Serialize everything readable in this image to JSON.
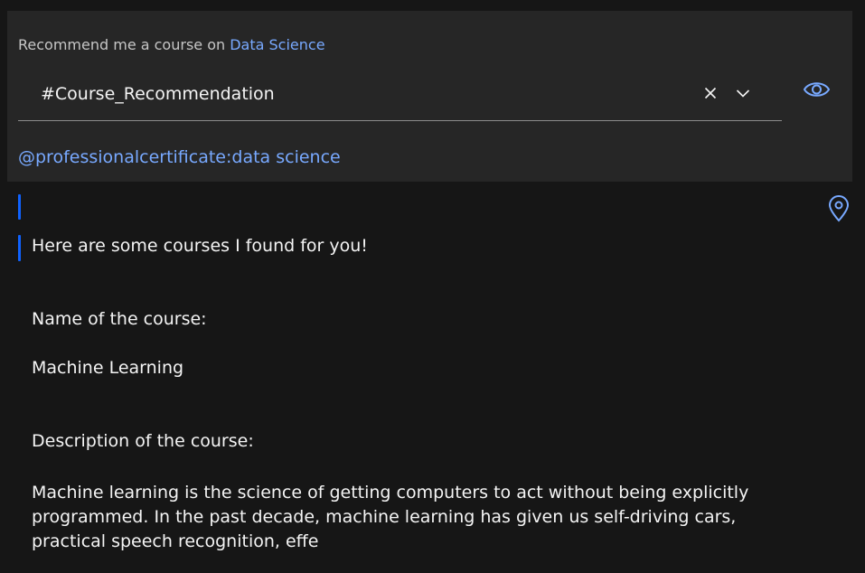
{
  "prompt": {
    "prefix": "Recommend me a course on ",
    "topic_link": "Data Science"
  },
  "dropdown": {
    "value": "#Course_Recommendation",
    "clear_icon": "close-icon",
    "expand_icon": "chevron-down-icon"
  },
  "mention": "@professionalcertificate:data science",
  "icons": {
    "eye": "eye-icon",
    "pin": "location-pin-icon"
  },
  "colors": {
    "background": "#161616",
    "panel": "#262626",
    "link": "#78a9ff",
    "accent": "#0f62fe",
    "text": "#f4f4f4"
  },
  "response": {
    "intro": "Here are some courses I found for you!",
    "name_label": "Name of the course:",
    "name_value": "Machine Learning",
    "description_label": "Description of the course:",
    "description_value": "Machine learning is the science of getting computers to act without being explicitly programmed. In the past decade, machine learning has given us self-driving cars, practical speech recognition, effe"
  }
}
